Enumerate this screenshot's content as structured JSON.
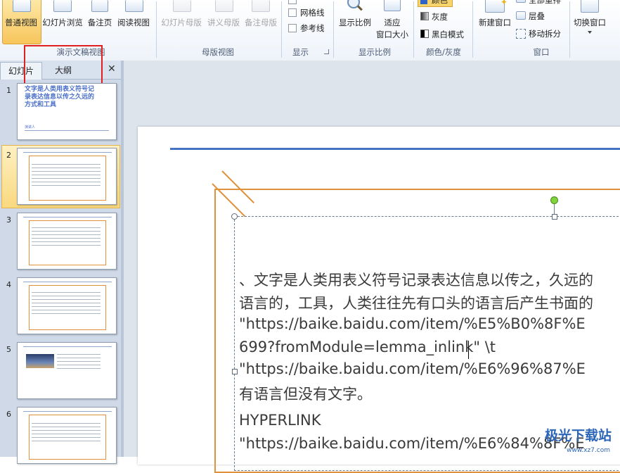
{
  "ribbon": {
    "view_buttons": [
      {
        "label": "普通视图"
      },
      {
        "label": "幻灯片浏览"
      },
      {
        "label": "备注页"
      },
      {
        "label": "阅读视图"
      }
    ],
    "group_presentation_views": "演示文稿视图",
    "master_buttons": [
      {
        "label": "幻灯片母版"
      },
      {
        "label": "讲义母版"
      },
      {
        "label": "备注母版"
      }
    ],
    "group_master_views": "母版视图",
    "show_checks": [
      {
        "label": "网格线"
      },
      {
        "label": "参考线"
      }
    ],
    "group_show": "显示",
    "zoom_label": "显示比例",
    "fit_label_1": "适应",
    "fit_label_2": "窗口大小",
    "group_zoom": "显示比例",
    "color_options": [
      {
        "label": "颜色"
      },
      {
        "label": "灰度"
      },
      {
        "label": "黑白模式"
      }
    ],
    "group_color": "颜色/灰度",
    "new_window_label": "新建窗口",
    "arrange_options": [
      {
        "label": "全部重排"
      },
      {
        "label": "层叠"
      },
      {
        "label": "移动拆分"
      }
    ],
    "switch_window_label": "切换窗口",
    "group_window": "窗口"
  },
  "panel": {
    "tab_slides": "幻灯片",
    "tab_outline": "大纲",
    "close_glyph": "✕",
    "slides": [
      {
        "num": "1",
        "title": "文字是人类用表义符号记录表达信息以传之久远的方式和工具",
        "subtitle": "演讲人"
      },
      {
        "num": "2"
      },
      {
        "num": "3"
      },
      {
        "num": "4"
      },
      {
        "num": "5"
      },
      {
        "num": "6"
      }
    ],
    "selected_index": 2
  },
  "slide": {
    "lines": [
      "、文字是人类用表义符号记录表达信息以传之，久远的",
      "语言的，工具，人类往往先有口头的语言后产生书面的",
      "\"https://baike.baidu.com/item/%E5%B0%8F%E",
      "699?fromModule=lemma_inlink\"  \\t",
      "\"https://baike.baidu.com/item/%E6%96%87%E",
      "有语言但没有文字。",
      "HYPERLINK",
      "\"https://baike.baidu.com/item/%E6%84%8F%E"
    ]
  },
  "watermark": {
    "text": "极光下载站",
    "sub": "www.xz7.com"
  },
  "colors": {
    "highlight_red": "#e02020",
    "frame_orange": "#e0913b",
    "rule_blue": "#4472c4"
  }
}
